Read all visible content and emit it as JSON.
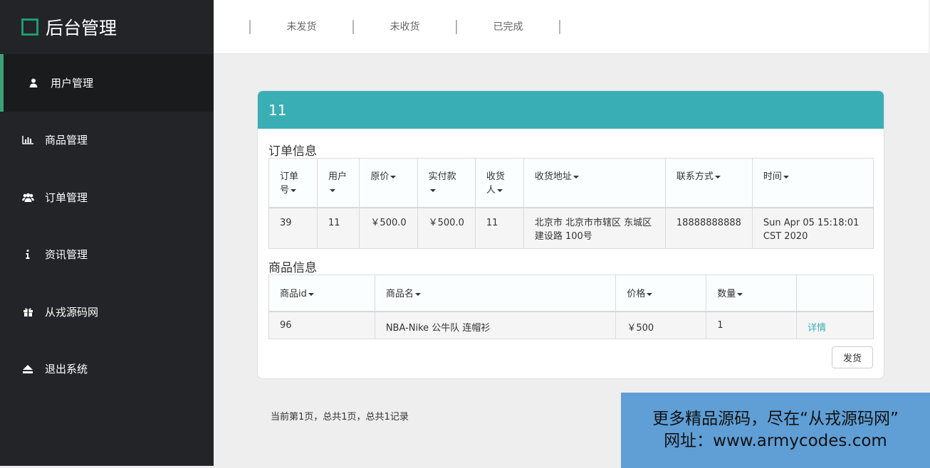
{
  "brand": {
    "title": "后台管理"
  },
  "sidebar": {
    "items": [
      {
        "label": "用户管理",
        "icon": "user-icon"
      },
      {
        "label": "商品管理",
        "icon": "bar-chart-icon"
      },
      {
        "label": "订单管理",
        "icon": "users-icon"
      },
      {
        "label": "资讯管理",
        "icon": "info-icon"
      },
      {
        "label": "从戎源码网",
        "icon": "gift-icon"
      },
      {
        "label": "退出系统",
        "icon": "eject-icon"
      }
    ]
  },
  "tabs": [
    "未发货",
    "未收货",
    "已完成"
  ],
  "panel": {
    "title": "11",
    "order_section": "订单信息",
    "order_headers": [
      "订单号",
      "用户",
      "原价",
      "实付款",
      "收货人",
      "收货地址",
      "联系方式",
      "时间"
    ],
    "order_row": [
      "39",
      "11",
      "￥500.0",
      "￥500.0",
      "11",
      "北京市 北京市市辖区 东城区 建设路 100号",
      "18888888888",
      "Sun Apr 05 15:18:01 CST 2020"
    ],
    "goods_section": "商品信息",
    "goods_headers": [
      "商品id",
      "商品名",
      "价格",
      "数量",
      ""
    ],
    "goods_row": [
      "96",
      "NBA-Nike 公牛队 连帽衫",
      "￥500",
      "1",
      "详情"
    ],
    "ship_button": "发货"
  },
  "pager": "当前第1页，总共1页，总共1记录",
  "watermark": {
    "line1": "更多精品源码，尽在“从戎源码网”",
    "line2": "网址：www.armycodes.com"
  },
  "colors": {
    "accent": "#3aaeb5",
    "sidebar": "#222427",
    "active_bar": "#3d9f79"
  }
}
